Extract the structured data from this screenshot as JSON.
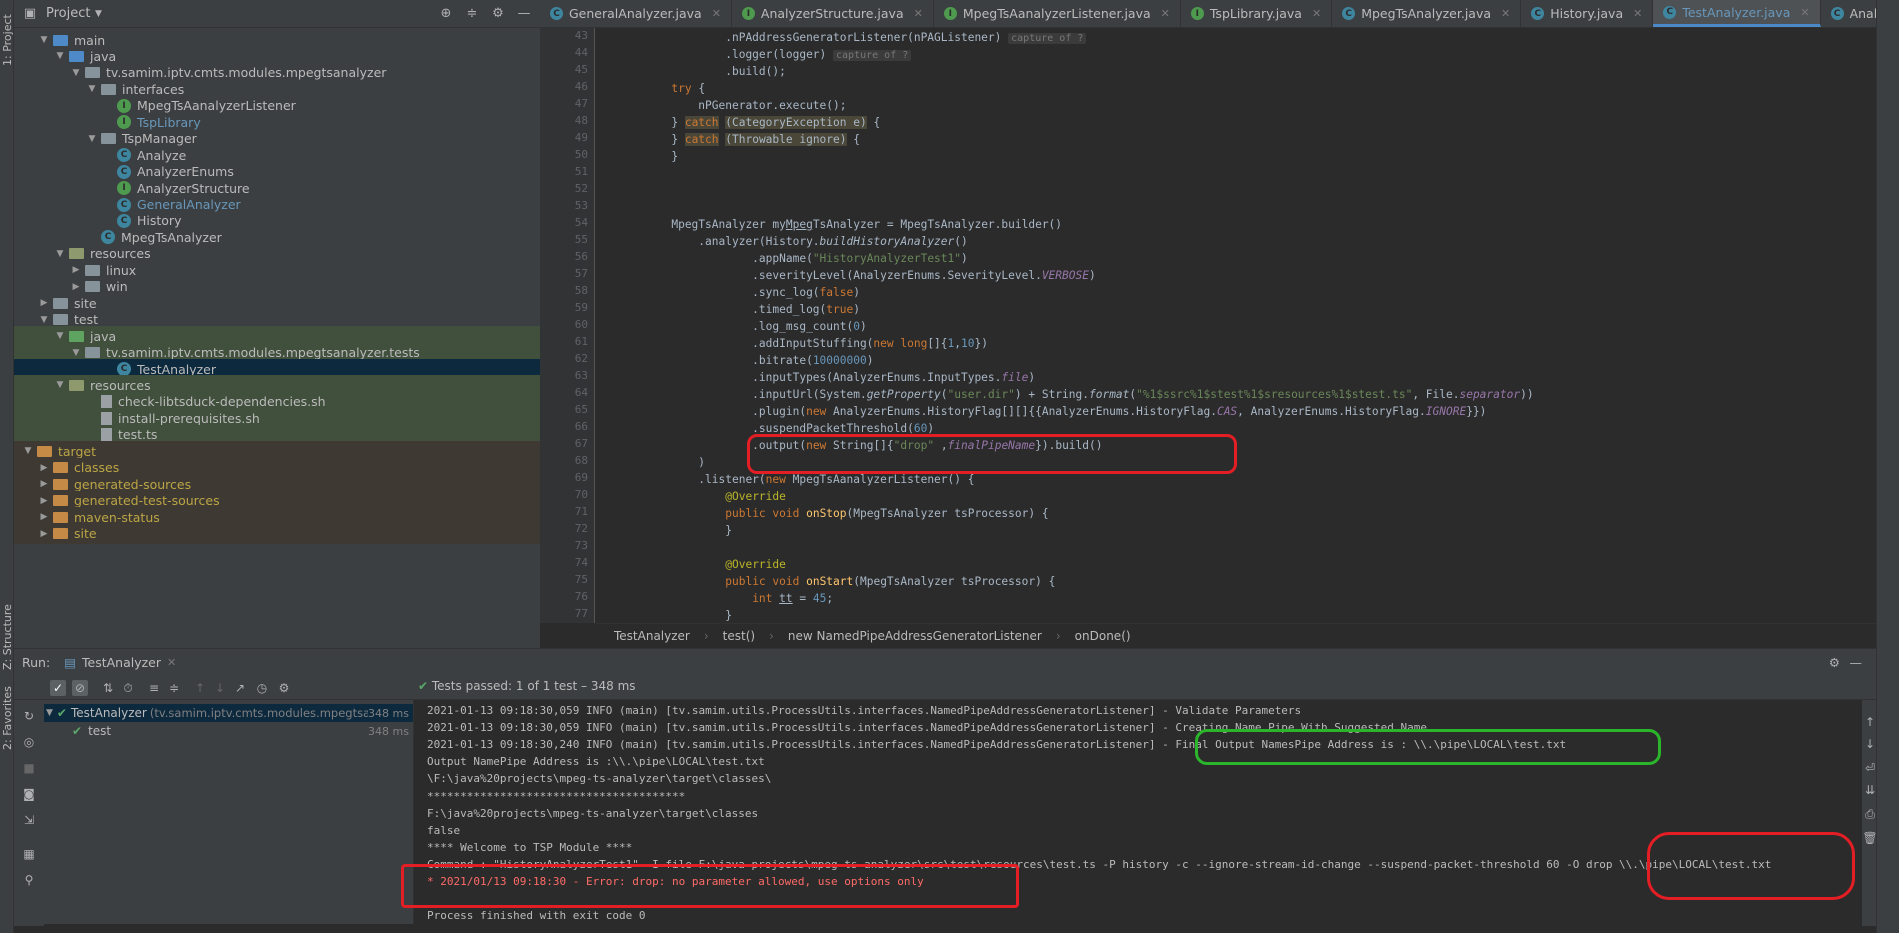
{
  "sidebar": {
    "project_label": "1: Project",
    "structure_label": "Z: Structure",
    "favorites_label": "2: Favorites"
  },
  "project_panel": {
    "title": "Project"
  },
  "tree": [
    {
      "indent": 2,
      "kind": "folder",
      "color": "src",
      "label": "main",
      "arrow": "▼"
    },
    {
      "indent": 3,
      "kind": "folder",
      "color": "src",
      "label": "java",
      "arrow": "▼"
    },
    {
      "indent": 4,
      "kind": "folder",
      "color": "plain",
      "label": "tv.samim.iptv.cmts.modules.mpegtsanalyzer",
      "arrow": "▼"
    },
    {
      "indent": 5,
      "kind": "folder",
      "color": "plain",
      "label": "interfaces",
      "arrow": "▼"
    },
    {
      "indent": 6,
      "kind": "iface",
      "label": "MpegTsAanalyzerListener",
      "arrow": ""
    },
    {
      "indent": 6,
      "kind": "iface",
      "label": "TspLibrary",
      "arrow": "",
      "style": "blue"
    },
    {
      "indent": 5,
      "kind": "folder",
      "color": "plain",
      "label": "TspManager",
      "arrow": "▼"
    },
    {
      "indent": 6,
      "kind": "class",
      "label": "Analyze",
      "arrow": ""
    },
    {
      "indent": 6,
      "kind": "class",
      "label": "AnalyzerEnums",
      "arrow": ""
    },
    {
      "indent": 6,
      "kind": "iface",
      "label": "AnalyzerStructure",
      "arrow": ""
    },
    {
      "indent": 6,
      "kind": "class",
      "label": "GeneralAnalyzer",
      "arrow": "",
      "style": "blue"
    },
    {
      "indent": 6,
      "kind": "class",
      "label": "History",
      "arrow": ""
    },
    {
      "indent": 5,
      "kind": "class",
      "label": "MpegTsAnalyzer",
      "arrow": ""
    },
    {
      "indent": 3,
      "kind": "folder",
      "color": "res",
      "label": "resources",
      "arrow": "▼"
    },
    {
      "indent": 4,
      "kind": "folder",
      "color": "plain",
      "label": "linux",
      "arrow": "▶"
    },
    {
      "indent": 4,
      "kind": "folder",
      "color": "plain",
      "label": "win",
      "arrow": "▶"
    },
    {
      "indent": 2,
      "kind": "folder",
      "color": "plain",
      "label": "site",
      "arrow": "▶"
    },
    {
      "indent": 2,
      "kind": "folder",
      "color": "plain",
      "label": "test",
      "arrow": "▼"
    },
    {
      "indent": 3,
      "kind": "folder",
      "color": "tst",
      "label": "java",
      "arrow": "▼",
      "row": "hl"
    },
    {
      "indent": 4,
      "kind": "folder",
      "color": "plain",
      "label": "tv.samim.iptv.cmts.modules.mpegtsanalyzer.tests",
      "arrow": "▼",
      "row": "hl"
    },
    {
      "indent": 6,
      "kind": "class",
      "label": "TestAnalyzer",
      "arrow": "",
      "row": "sel"
    },
    {
      "indent": 3,
      "kind": "folder",
      "color": "res",
      "label": "resources",
      "arrow": "▼",
      "row": "hl"
    },
    {
      "indent": 5,
      "kind": "file",
      "label": "check-libtsduck-dependencies.sh",
      "arrow": "",
      "row": "hl"
    },
    {
      "indent": 5,
      "kind": "file",
      "label": "install-prerequisites.sh",
      "arrow": "",
      "row": "hl"
    },
    {
      "indent": 5,
      "kind": "file",
      "label": "test.ts",
      "arrow": "",
      "row": "hl"
    },
    {
      "indent": 1,
      "kind": "folder",
      "color": "org",
      "label": "target",
      "arrow": "▼",
      "row": "tgt",
      "style": "yel"
    },
    {
      "indent": 2,
      "kind": "folder",
      "color": "org",
      "label": "classes",
      "arrow": "▶",
      "row": "tgt",
      "style": "yel"
    },
    {
      "indent": 2,
      "kind": "folder",
      "color": "org",
      "label": "generated-sources",
      "arrow": "▶",
      "row": "tgt",
      "style": "yel"
    },
    {
      "indent": 2,
      "kind": "folder",
      "color": "org",
      "label": "generated-test-sources",
      "arrow": "▶",
      "row": "tgt",
      "style": "yel"
    },
    {
      "indent": 2,
      "kind": "folder",
      "color": "org",
      "label": "maven-status",
      "arrow": "▶",
      "row": "tgt",
      "style": "yel"
    },
    {
      "indent": 2,
      "kind": "folder",
      "color": "org",
      "label": "site",
      "arrow": "▶",
      "row": "tgt",
      "style": "yel"
    }
  ],
  "tabs": [
    {
      "label": "GeneralAnalyzer.java",
      "kind": "class"
    },
    {
      "label": "AnalyzerStructure.java",
      "kind": "iface"
    },
    {
      "label": "MpegTsAanalyzerListener.java",
      "kind": "iface"
    },
    {
      "label": "TspLibrary.java",
      "kind": "iface"
    },
    {
      "label": "MpegTsAnalyzer.java",
      "kind": "class"
    },
    {
      "label": "History.java",
      "kind": "class"
    },
    {
      "label": "TestAnalyzer.java",
      "kind": "class",
      "active": true
    },
    {
      "label": "AnalyzerEnums.java",
      "kind": "class"
    }
  ],
  "code_lines": [
    {
      "n": "43",
      "html": "                  .nPAddressGeneratorListener(nPAGListener) <span class='hint'>capture of ?</span>"
    },
    {
      "n": "44",
      "html": "                  .logger(logger) <span class='hint'>capture of ?</span>"
    },
    {
      "n": "45",
      "html": "                  .build();"
    },
    {
      "n": "46",
      "html": "          <span class='kw'>try</span> {"
    },
    {
      "n": "47",
      "html": "              nPGenerator.execute();"
    },
    {
      "n": "48",
      "html": "          } <span class='kw catchbg'>catch</span> <span class='catchbg'>(CategoryException e)</span> {"
    },
    {
      "n": "49",
      "html": "          } <span class='kw catchbg'>catch</span> <span class='catchbg'>(Throwable ignore)</span> {"
    },
    {
      "n": "50",
      "html": "          }"
    },
    {
      "n": "51",
      "html": ""
    },
    {
      "n": "52",
      "html": ""
    },
    {
      "n": "53",
      "html": ""
    },
    {
      "n": "54",
      "html": "          MpegTsAnalyzer my<u>Mpeg</u>TsAnalyzer = MpegTsAnalyzer.builder()"
    },
    {
      "n": "55",
      "html": "              .analyzer(History.<i>buildHistoryAnalyzer</i>()"
    },
    {
      "n": "56",
      "html": "                      .appName(<span class='str'>\"HistoryAnalyzerTest1\"</span>)"
    },
    {
      "n": "57",
      "html": "                      .severityLevel(AnalyzerEnums.SeverityLevel.<span class='it'>VERBOSE</span>)"
    },
    {
      "n": "58",
      "html": "                      .sync_log(<span class='kw'>false</span>)"
    },
    {
      "n": "59",
      "html": "                      .timed_log(<span class='kw'>true</span>)"
    },
    {
      "n": "60",
      "html": "                      .log_msg_count(<span class='num'>0</span>)"
    },
    {
      "n": "61",
      "html": "                      .addInputStuffing(<span class='kw'>new long</span>[]{<span class='num'>1</span>,<span class='num'>10</span>})"
    },
    {
      "n": "62",
      "html": "                      .bitrate(<span class='num'>10000000</span>)"
    },
    {
      "n": "63",
      "html": "                      .inputTypes(AnalyzerEnums.InputTypes.<span class='it'>file</span>)"
    },
    {
      "n": "64",
      "html": "                      .inputUrl(System.<i>getProperty</i>(<span class='str'>\"user.dir\"</span>) + String.<i>format</i>(<span class='str'>\"%1$ssrc%1$stest%1$sresources%1$stest.ts\"</span>, File.<span class='it'>separator</span>))"
    },
    {
      "n": "65",
      "html": "                      .plugin(<span class='kw'>new</span> AnalyzerEnums.HistoryFlag[][]{{AnalyzerEnums.HistoryFlag.<span class='it'>CAS</span>, AnalyzerEnums.HistoryFlag.<span class='it'>IGNORE</span>}})"
    },
    {
      "n": "66",
      "html": "                      .suspendPacketThreshold(<span class='num'>60</span>)"
    },
    {
      "n": "67",
      "html": "                      .output(<span class='kw'>new</span> String[]{<span class='str'>\"drop\"</span> ,<span class='it'>finalPipeName</span>}).build()"
    },
    {
      "n": "68",
      "html": "              )"
    },
    {
      "n": "69",
      "html": "              .listener(<span class='kw'>new</span> MpegTsAanalyzerListener() {"
    },
    {
      "n": "70",
      "html": "                  <span class='ann'>@Override</span>"
    },
    {
      "n": "71",
      "html": "                  <span class='kw'>public void</span> <span class='fn'>onStop</span>(MpegTsAnalyzer tsProcessor) {"
    },
    {
      "n": "72",
      "html": "                  }"
    },
    {
      "n": "73",
      "html": ""
    },
    {
      "n": "74",
      "html": "                  <span class='ann'>@Override</span>"
    },
    {
      "n": "75",
      "html": "                  <span class='kw'>public void</span> <span class='fn'>onStart</span>(MpegTsAnalyzer tsProcessor) {"
    },
    {
      "n": "76",
      "html": "                      <span class='kw'>int</span> <u>tt</u> = <span class='num'>45</span>;"
    },
    {
      "n": "77",
      "html": "                  }"
    }
  ],
  "breadcrumb": [
    "TestAnalyzer",
    "test()",
    "new NamedPipeAddressGeneratorListener",
    "onDone()"
  ],
  "run": {
    "label": "Run:",
    "tab": "TestAnalyzer",
    "passed": "Tests passed: 1 of 1 test – 348 ms",
    "root_label": "TestAnalyzer",
    "root_sub": "(tv.samim.iptv.cmts.modules.mpegtsana",
    "root_time": "348 ms",
    "child_label": "test",
    "child_time": "348 ms"
  },
  "console": [
    {
      "t": "2021-01-13 09:18:30,059 INFO (main) [tv.samim.utils.ProcessUtils.interfaces.NamedPipeAddressGeneratorListener] - Validate Parameters"
    },
    {
      "t": "2021-01-13 09:18:30,059 INFO (main) [tv.samim.utils.ProcessUtils.interfaces.NamedPipeAddressGeneratorListener] - Creating Name Pipe With Suggested Name"
    },
    {
      "t": "2021-01-13 09:18:30,240 INFO (main) [tv.samim.utils.ProcessUtils.interfaces.NamedPipeAddressGeneratorListener] - Final Output NamesPipe Address is : \\\\.\\pipe\\LOCAL\\test.txt"
    },
    {
      "t": "Output NamePipe Address is :\\\\.\\pipe\\LOCAL\\test.txt"
    },
    {
      "t": "\\F:\\java%20projects\\mpeg-ts-analyzer\\target\\classes\\"
    },
    {
      "t": "***************************************"
    },
    {
      "t": "F:\\java%20projects\\mpeg-ts-analyzer\\target\\classes"
    },
    {
      "t": "false"
    },
    {
      "t": "**** Welcome to TSP Module ****"
    },
    {
      "t": "Command : \"HistoryAnalyzerTest1\" -I file F:\\java projects\\mpeg-ts-analyzer\\src\\test\\resources\\test.ts -P history -c --ignore-stream-id-change --suspend-packet-threshold 60 -O drop \\\\.\\pipe\\LOCAL\\test.txt"
    },
    {
      "t": "* 2021/01/13 09:18:30 - Error: drop: no parameter allowed, use options only",
      "err": true
    },
    {
      "t": ""
    },
    {
      "t": "Process finished with exit code 0"
    }
  ]
}
